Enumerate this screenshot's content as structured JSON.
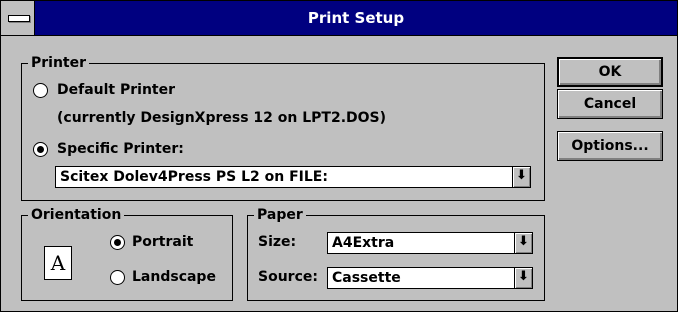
{
  "window": {
    "title": "Print Setup"
  },
  "printer": {
    "legend": "Printer",
    "default_label": "Default Printer",
    "default_detail": "(currently DesignXpress 12 on LPT2.DOS)",
    "specific_label": "Specific Printer:",
    "specific_value": "Scitex Dolev4Press PS L2 on FILE:"
  },
  "orientation": {
    "legend": "Orientation",
    "page_glyph": "A",
    "portrait_label": "Portrait",
    "landscape_label": "Landscape"
  },
  "paper": {
    "legend": "Paper",
    "size_label": "Size:",
    "size_value": "A4Extra",
    "source_label": "Source:",
    "source_value": "Cassette"
  },
  "buttons": {
    "ok": "OK",
    "cancel": "Cancel",
    "options": "Options..."
  },
  "icons": {
    "dropdown": "⬇"
  }
}
